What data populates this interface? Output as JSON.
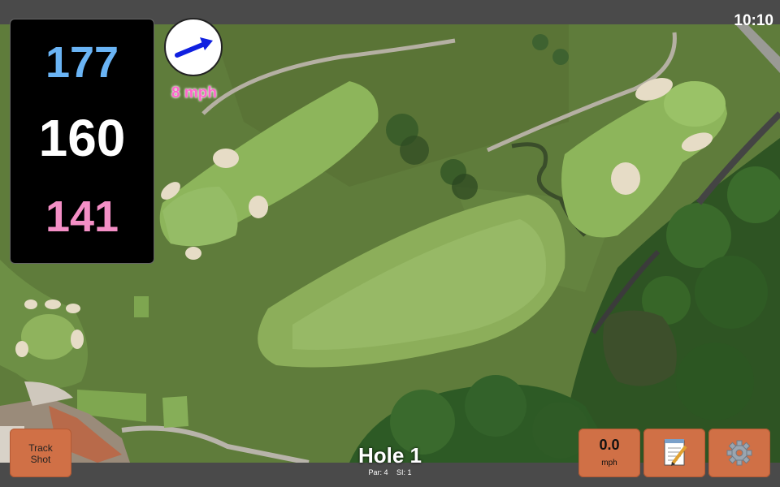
{
  "status": {
    "time": "10:10"
  },
  "distances": {
    "back": "177",
    "middle": "160",
    "front": "141",
    "colors": {
      "back": "#6ab4f5",
      "middle": "#ffffff",
      "front": "#f48fc6"
    }
  },
  "wind": {
    "speed_label": "8 mph",
    "direction_icon": "wind-direction-arrow-icon",
    "arrow_color": "#1020e0"
  },
  "hole": {
    "title": "Hole 1",
    "par": "Par: 4",
    "si": "SI: 1"
  },
  "buttons": {
    "track_shot": "Track\nShot",
    "speed_value": "0.0",
    "speed_unit": "mph",
    "notes_icon": "notepad-icon",
    "settings_icon": "gear-icon"
  },
  "colors": {
    "button": "#d07046",
    "bar": "#4a4a4a"
  }
}
